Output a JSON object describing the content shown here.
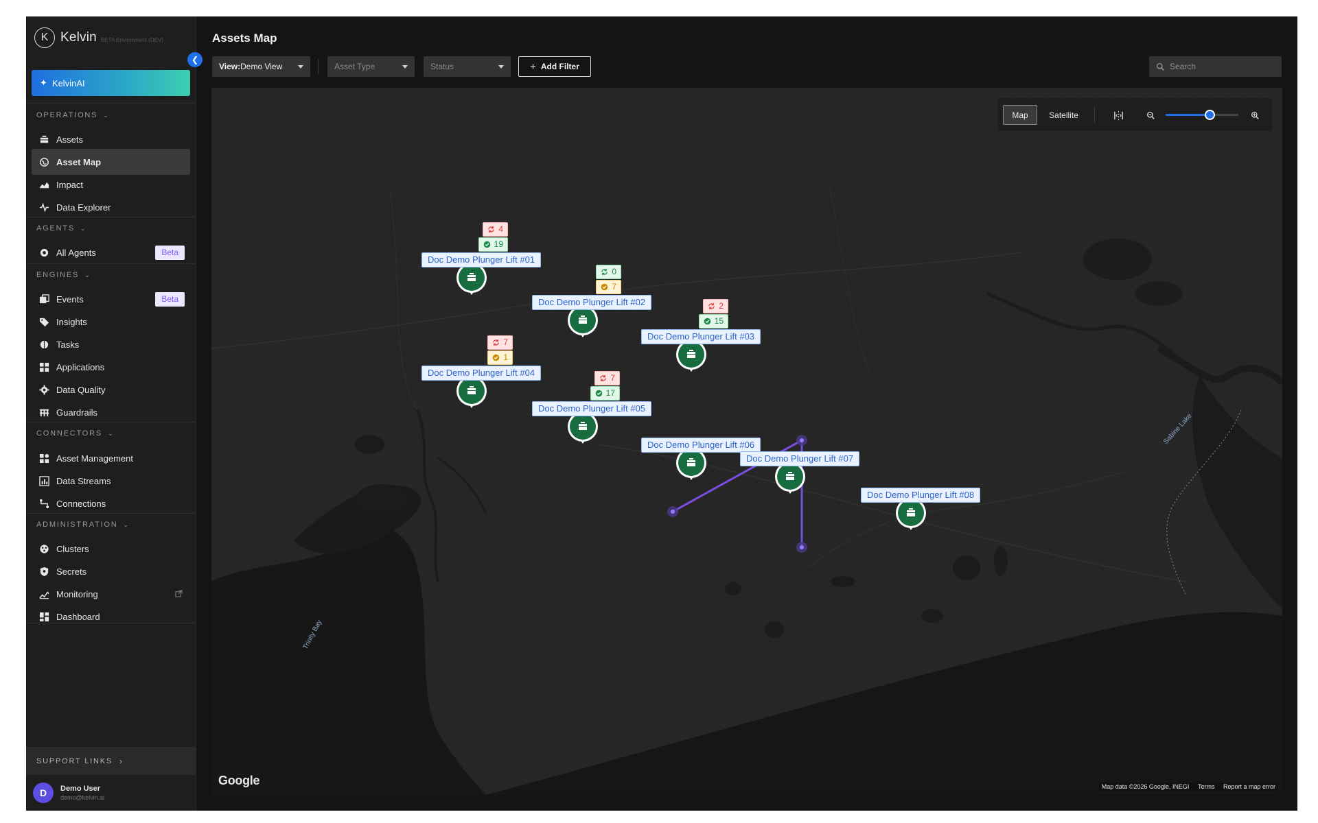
{
  "brand": {
    "name": "Kelvin",
    "logo_letter": "K",
    "environment": "BETA Environment (DEV)"
  },
  "sidebar": {
    "ai_button": "KelvinAI",
    "sections": [
      {
        "title": "OPERATIONS",
        "items": [
          {
            "label": "Assets",
            "icon": "assets-icon"
          },
          {
            "label": "Asset Map",
            "icon": "globe-icon",
            "active": true
          },
          {
            "label": "Impact",
            "icon": "impact-icon"
          },
          {
            "label": "Data Explorer",
            "icon": "pulse-icon"
          }
        ]
      },
      {
        "title": "AGENTS",
        "items": [
          {
            "label": "All Agents",
            "icon": "agent-icon",
            "badge": "Beta"
          }
        ]
      },
      {
        "title": "ENGINES",
        "items": [
          {
            "label": "Events",
            "icon": "events-icon",
            "badge": "Beta"
          },
          {
            "label": "Insights",
            "icon": "tag-icon"
          },
          {
            "label": "Tasks",
            "icon": "tasks-icon"
          },
          {
            "label": "Applications",
            "icon": "apps-icon"
          },
          {
            "label": "Data Quality",
            "icon": "gear-icon"
          },
          {
            "label": "Guardrails",
            "icon": "guardrail-icon"
          }
        ]
      },
      {
        "title": "CONNECTORS",
        "items": [
          {
            "label": "Asset Management",
            "icon": "asset-mgmt-icon"
          },
          {
            "label": "Data Streams",
            "icon": "bar-chart-icon"
          },
          {
            "label": "Connections",
            "icon": "connections-icon"
          }
        ]
      },
      {
        "title": "ADMINISTRATION",
        "items": [
          {
            "label": "Clusters",
            "icon": "clusters-icon"
          },
          {
            "label": "Secrets",
            "icon": "shield-icon"
          },
          {
            "label": "Monitoring",
            "icon": "monitoring-icon",
            "external": true
          },
          {
            "label": "Dashboard",
            "icon": "dashboard-icon"
          }
        ]
      }
    ],
    "support": "SUPPORT LINKS",
    "user": {
      "initial": "D",
      "name": "Demo User",
      "email": "demo@kelvin.ai"
    }
  },
  "header": {
    "title": "Assets Map",
    "view_prefix": "View:",
    "view_value": "Demo View",
    "asset_type_placeholder": "Asset Type",
    "status_placeholder": "Status",
    "add_filter": "Add Filter",
    "search_placeholder": "Search"
  },
  "map": {
    "mode_map": "Map",
    "mode_satellite": "Satellite",
    "zoom_level": 0.6,
    "google": "Google",
    "attribution": "Map data ©2026 Google, INEGI",
    "terms": "Terms",
    "report": "Report a map error",
    "place_labels": [
      "Sabine Lake",
      "Trinity Bay"
    ],
    "assets": [
      {
        "name": "Doc Demo Plunger Lift #01",
        "chips": [
          {
            "type": "red",
            "icon": "recommendation-icon",
            "value": "4"
          },
          {
            "type": "green",
            "icon": "check-icon",
            "value": "19"
          }
        ]
      },
      {
        "name": "Doc Demo Plunger Lift #02",
        "chips": [
          {
            "type": "green",
            "icon": "recommendation-icon",
            "value": "0"
          },
          {
            "type": "yellow",
            "icon": "check-icon",
            "value": "7"
          }
        ]
      },
      {
        "name": "Doc Demo Plunger Lift #03",
        "chips": [
          {
            "type": "red",
            "icon": "recommendation-icon",
            "value": "2"
          },
          {
            "type": "green",
            "icon": "check-icon",
            "value": "15"
          }
        ]
      },
      {
        "name": "Doc Demo Plunger Lift #04",
        "chips": [
          {
            "type": "red",
            "icon": "recommendation-icon",
            "value": "7"
          },
          {
            "type": "yellow",
            "icon": "check-icon",
            "value": "1"
          }
        ]
      },
      {
        "name": "Doc Demo Plunger Lift #05",
        "chips": [
          {
            "type": "red",
            "icon": "recommendation-icon",
            "value": "7"
          },
          {
            "type": "green",
            "icon": "check-icon",
            "value": "17"
          }
        ]
      },
      {
        "name": "Doc Demo Plunger Lift #06",
        "chips": []
      },
      {
        "name": "Doc Demo Plunger Lift #07",
        "chips": []
      },
      {
        "name": "Doc Demo Plunger Lift #08",
        "chips": []
      }
    ]
  },
  "colors": {
    "accent": "#1f6feb",
    "marker": "#176d3f",
    "connection": "#7b4de0",
    "beta": "#7c5cff"
  }
}
